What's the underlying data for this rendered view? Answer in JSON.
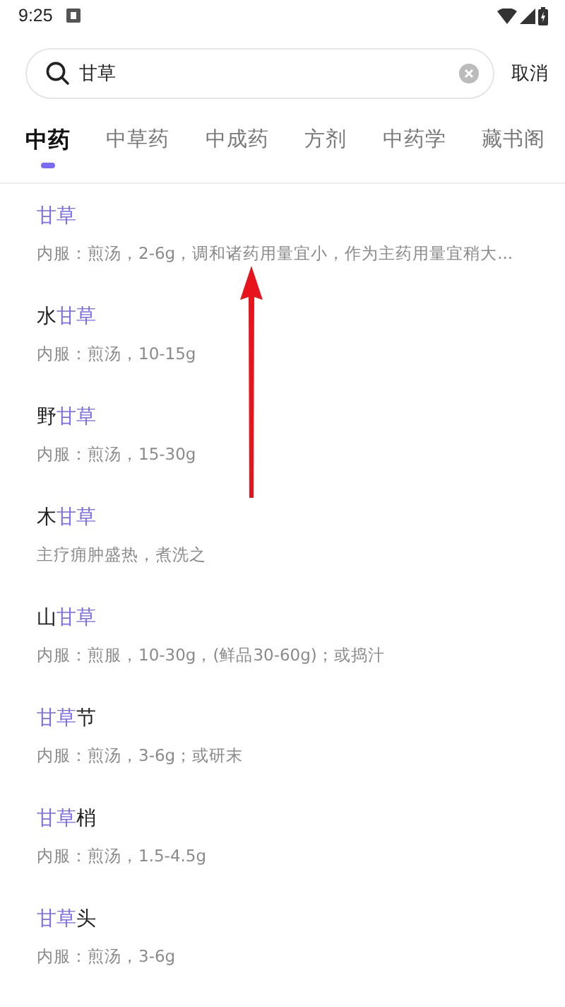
{
  "status_bar": {
    "time": "9:25"
  },
  "search": {
    "value": "甘草",
    "cancel": "取消"
  },
  "tabs": [
    {
      "label": "中药",
      "selected": true
    },
    {
      "label": "中草药",
      "selected": false
    },
    {
      "label": "中成药",
      "selected": false
    },
    {
      "label": "方剂",
      "selected": false
    },
    {
      "label": "中药学",
      "selected": false
    },
    {
      "label": "藏书阁",
      "selected": false
    }
  ],
  "results": [
    {
      "title": [
        {
          "text": "甘草",
          "kind": "match"
        }
      ],
      "desc": "内服：煎汤，2-6g，调和诸药用量宜小，作为主药用量宜稍大..."
    },
    {
      "title": [
        {
          "text": "水",
          "kind": "plain"
        },
        {
          "text": "甘草",
          "kind": "match"
        }
      ],
      "desc": "内服：煎汤，10-15g"
    },
    {
      "title": [
        {
          "text": "野",
          "kind": "plain"
        },
        {
          "text": "甘草",
          "kind": "match"
        }
      ],
      "desc": "内服：煎汤，15-30g"
    },
    {
      "title": [
        {
          "text": "木",
          "kind": "plain"
        },
        {
          "text": "甘草",
          "kind": "match"
        }
      ],
      "desc": "主疗痈肿盛热，煮洗之"
    },
    {
      "title": [
        {
          "text": "山",
          "kind": "plain"
        },
        {
          "text": "甘草",
          "kind": "match"
        }
      ],
      "desc": "内服：煎服，10-30g，(鲜品30-60g)；或捣汁"
    },
    {
      "title": [
        {
          "text": "甘草",
          "kind": "match"
        },
        {
          "text": "节",
          "kind": "plain"
        }
      ],
      "desc": "内服：煎汤，3-6g；或研末"
    },
    {
      "title": [
        {
          "text": "甘草",
          "kind": "match"
        },
        {
          "text": "梢",
          "kind": "plain"
        }
      ],
      "desc": "内服：煎汤，1.5-4.5g"
    },
    {
      "title": [
        {
          "text": "甘草",
          "kind": "match"
        },
        {
          "text": "头",
          "kind": "plain"
        }
      ],
      "desc": "内服：煎汤，3-6g"
    }
  ],
  "annotations": [
    {
      "kind": "arrow"
    }
  ]
}
